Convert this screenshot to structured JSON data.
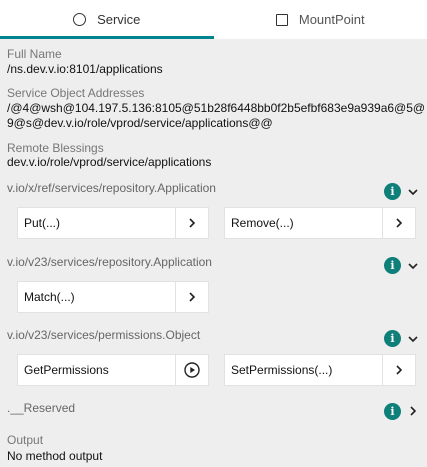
{
  "tabs": [
    {
      "label": "Service",
      "icon": "radio-icon",
      "active": true
    },
    {
      "label": "MountPoint",
      "icon": "checkbox-icon",
      "active": false
    }
  ],
  "details": {
    "full_name_label": "Full Name",
    "full_name_value": "/ns.dev.v.io:8101/applications",
    "addresses_label": "Service Object Addresses",
    "addresses_value": "/@4@wsh@104.197.5.136:8105@51b28f6448bb0f2b5efbf683e9a939a6@5@9@s@dev.v.io/role/vprod/service/applications@@",
    "blessings_label": "Remote Blessings",
    "blessings_value": "dev.v.io/role/vprod/service/applications"
  },
  "interfaces": [
    {
      "name": "v.io/x/ref/services/repository.Application",
      "methods": [
        {
          "label": "Put(...)",
          "action": "chevron-right-icon"
        },
        {
          "label": "Remove(...)",
          "action": "chevron-right-icon"
        }
      ]
    },
    {
      "name": "v.io/v23/services/repository.Application",
      "methods": [
        {
          "label": "Match(...)",
          "action": "chevron-right-icon"
        }
      ]
    },
    {
      "name": "v.io/v23/services/permissions.Object",
      "methods": [
        {
          "label": "GetPermissions",
          "action": "play-circle-icon"
        },
        {
          "label": "SetPermissions(...)",
          "action": "chevron-right-icon"
        }
      ]
    },
    {
      "name": ".__Reserved",
      "methods": []
    }
  ],
  "output": {
    "label": "Output",
    "value": "No method output"
  },
  "colors": {
    "accent": "#00838f",
    "info_icon": "#0e7f79",
    "background": "#eeeeee"
  }
}
